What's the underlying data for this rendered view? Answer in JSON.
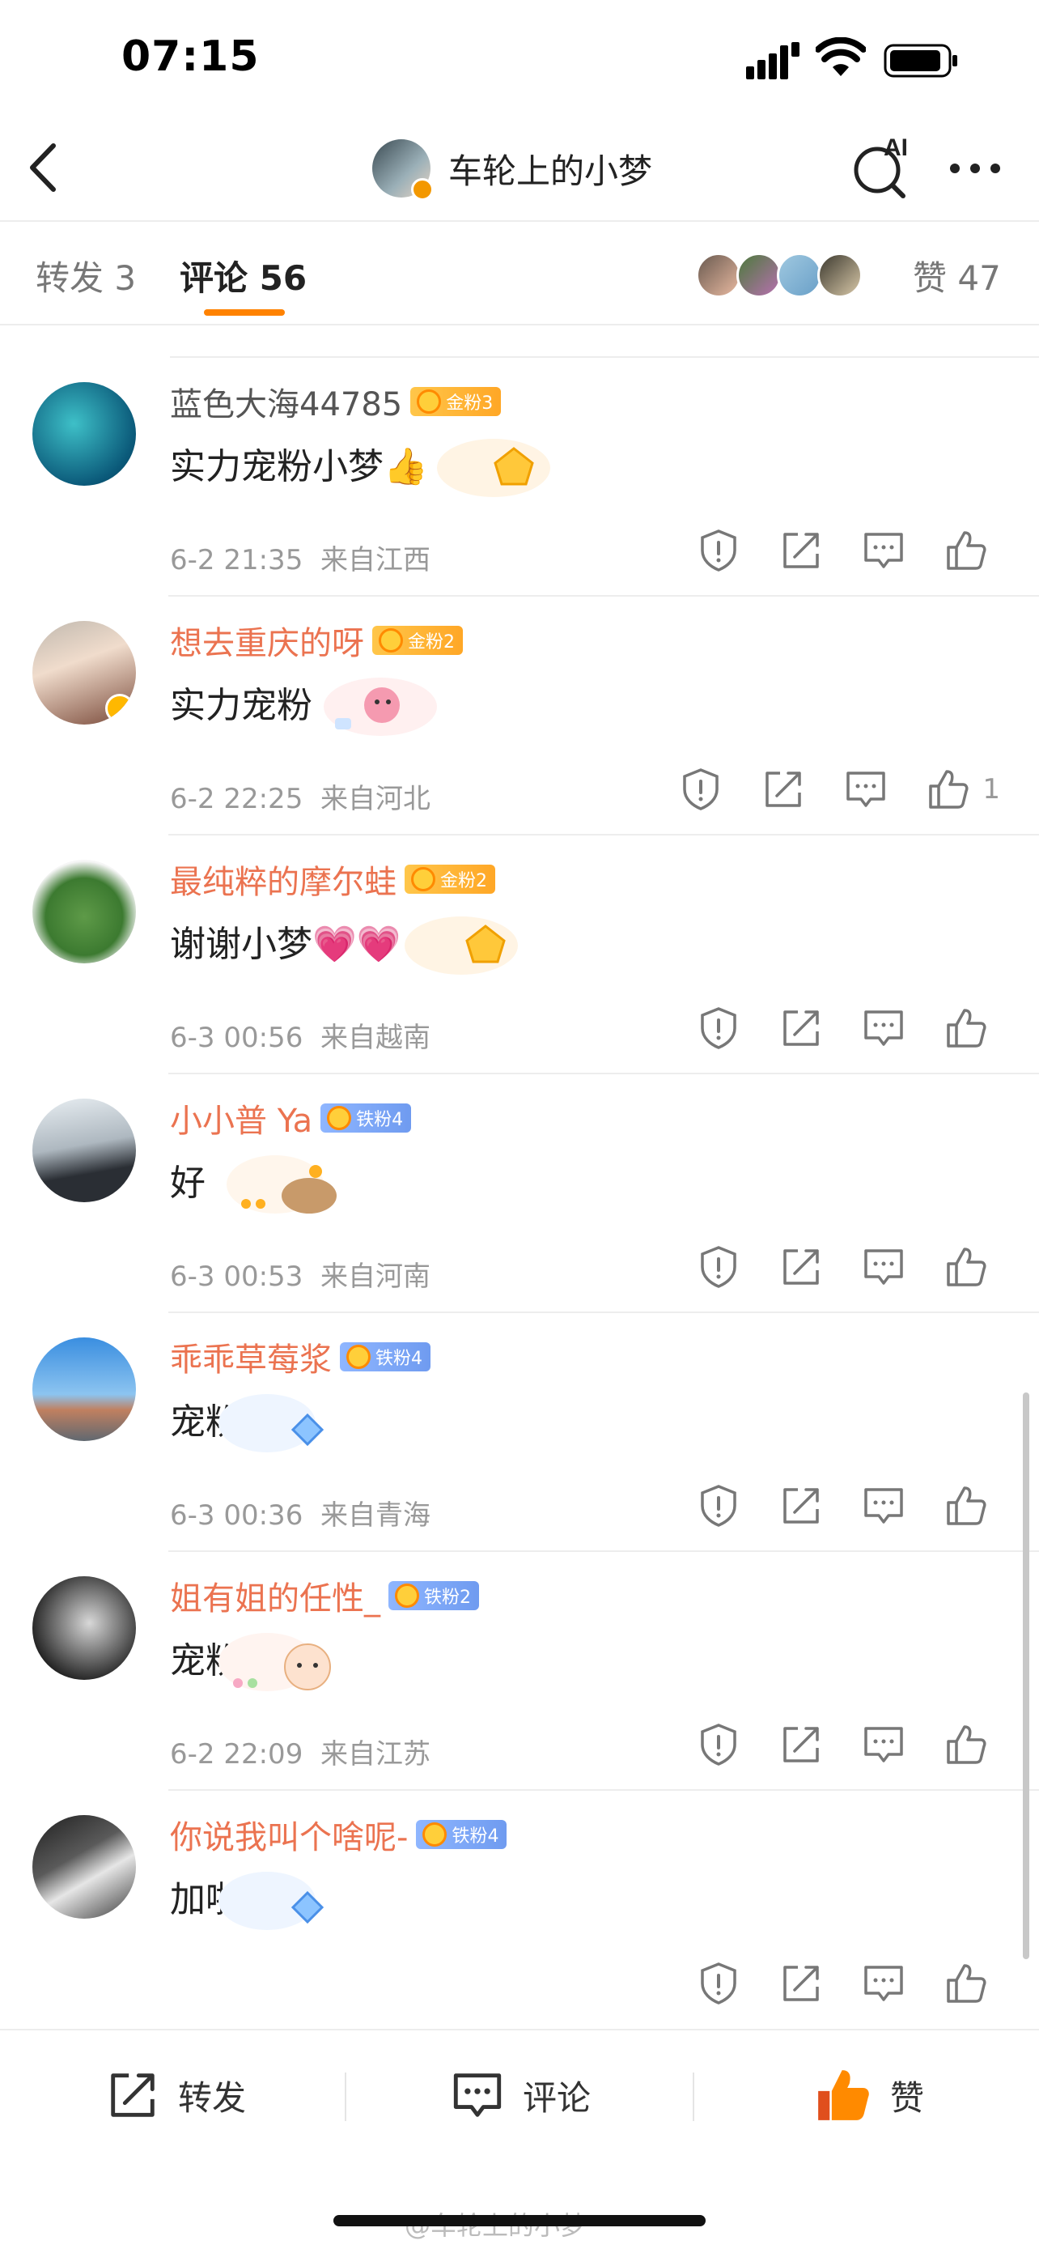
{
  "status_bar": {
    "time": "07:15"
  },
  "header": {
    "title": "车轮上的小梦",
    "ai_label": "AI"
  },
  "tabs": {
    "repost": "转发 3",
    "comment": "评论 56",
    "likes": "赞 47"
  },
  "comments": [
    {
      "name": "蓝色大海44785",
      "badge": "金粉3",
      "badge_type": "gold",
      "text": "实力宠粉小梦👍",
      "time": "6-2 21:35",
      "location": "来自江西",
      "likes": ""
    },
    {
      "name": "想去重庆的呀",
      "badge": "金粉2",
      "badge_type": "gold",
      "text": "实力宠粉",
      "time": "6-2 22:25",
      "location": "来自河北",
      "likes": "1"
    },
    {
      "name": "最纯粹的摩尔蛙",
      "badge": "金粉2",
      "badge_type": "gold",
      "text": "谢谢小梦💗💗",
      "time": "6-3 00:56",
      "location": "来自越南",
      "likes": ""
    },
    {
      "name": "小小普 Ya",
      "badge": "铁粉4",
      "badge_type": "iron",
      "text": "好",
      "time": "6-3 00:53",
      "location": "来自河南",
      "likes": ""
    },
    {
      "name": "乖乖草莓浆",
      "badge": "铁粉4",
      "badge_type": "iron",
      "text": "宠粉",
      "time": "6-3 00:36",
      "location": "来自青海",
      "likes": ""
    },
    {
      "name": "姐有姐的任性_",
      "badge": "铁粉2",
      "badge_type": "iron",
      "text": "宠粉",
      "time": "6-2 22:09",
      "location": "来自江苏",
      "likes": ""
    },
    {
      "name": "你说我叫个啥呢-",
      "badge": "铁粉4",
      "badge_type": "iron",
      "text": "加啦",
      "time": "",
      "location": "",
      "likes": ""
    }
  ],
  "toolbar": {
    "repost": "转发",
    "comment": "评论",
    "like": "赞"
  },
  "watermark": "@车轮上的小梦",
  "colors": {
    "accent": "#ff8200",
    "username": "#eb7350",
    "meta": "#999999"
  }
}
